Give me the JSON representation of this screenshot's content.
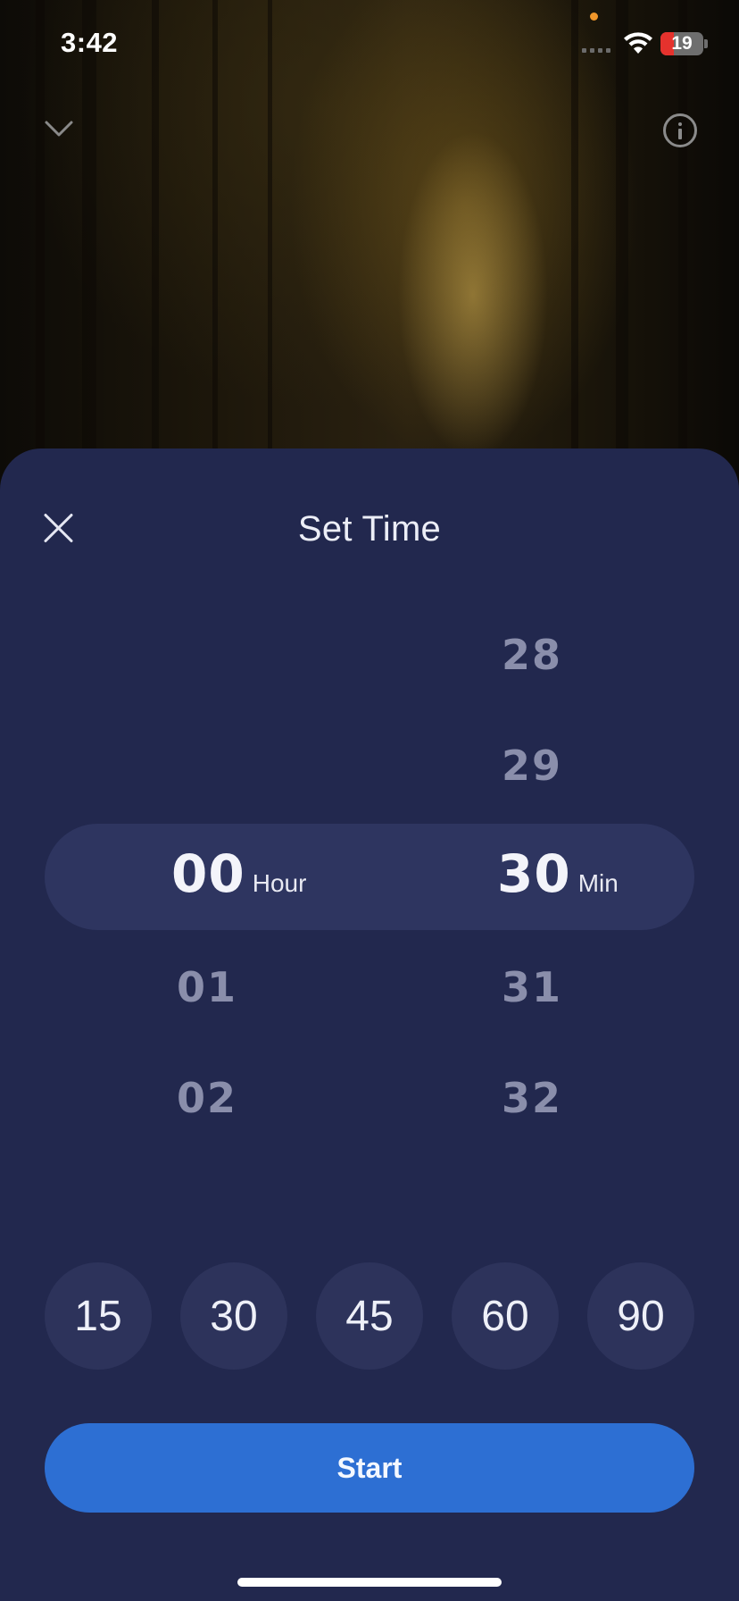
{
  "status_bar": {
    "time": "3:42",
    "battery_level": "19",
    "battery_color": "#e5322d",
    "wifi_icon": "wifi-icon",
    "signal_icon": "cellular-signal-icon"
  },
  "header": {
    "collapse_icon": "chevron-down-icon",
    "info_icon": "info-icon"
  },
  "sheet": {
    "title": "Set Time",
    "close_icon": "close-icon",
    "background_color": "#22284e"
  },
  "picker": {
    "hours": {
      "above": [],
      "selected": "00",
      "below": [
        "01",
        "02"
      ],
      "unit": "Hour"
    },
    "minutes": {
      "above": [
        "28",
        "29"
      ],
      "selected": "30",
      "below": [
        "31",
        "32"
      ],
      "unit": "Min"
    }
  },
  "presets": [
    "15",
    "30",
    "45",
    "60",
    "90"
  ],
  "start_button": {
    "label": "Start",
    "color": "#2d6fd3"
  }
}
